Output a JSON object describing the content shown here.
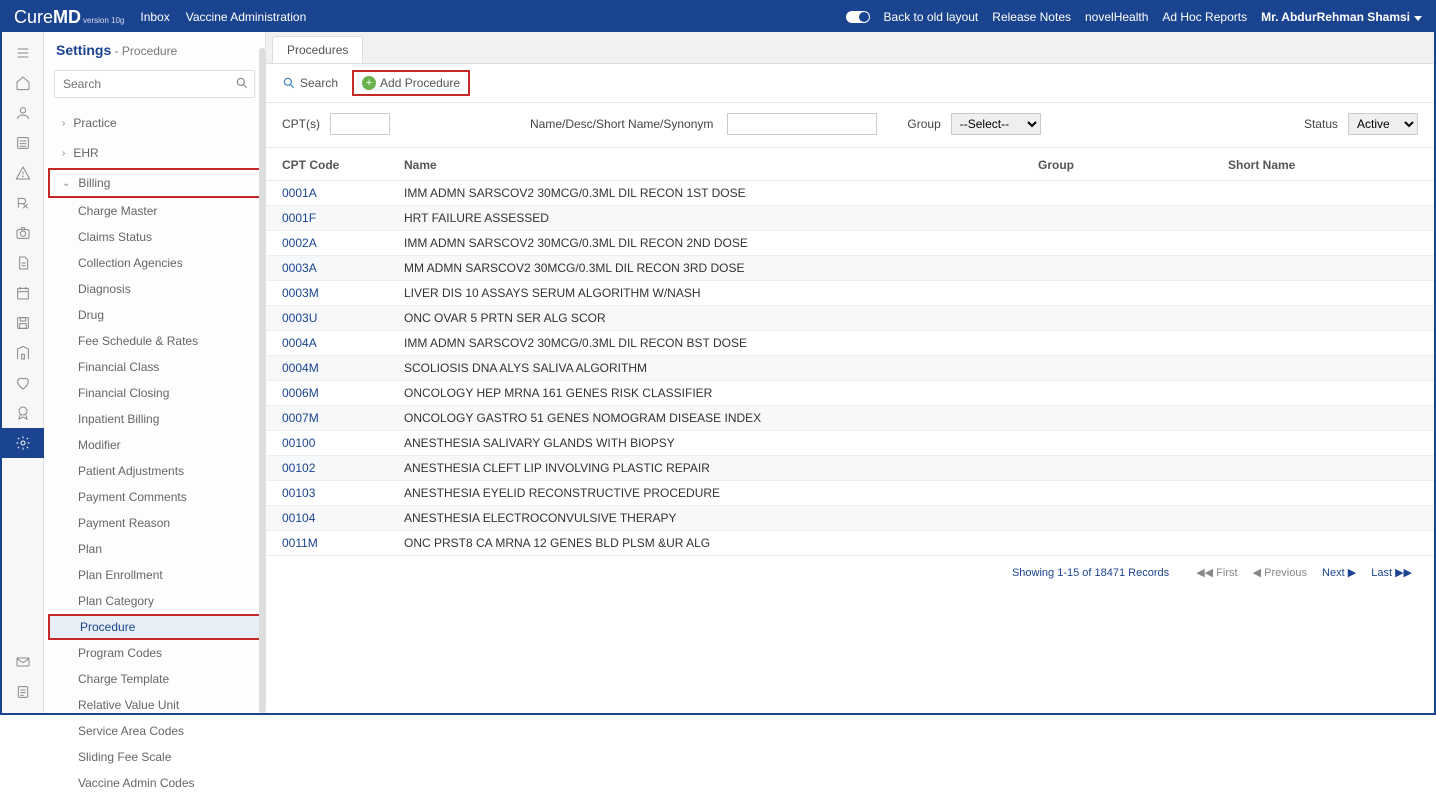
{
  "header": {
    "logo_text_a": "Cure",
    "logo_text_b": "MD",
    "logo_version": "version 10g",
    "links_left": [
      "Inbox",
      "Vaccine Administration"
    ],
    "links_right": [
      "Back to old layout",
      "Release Notes",
      "novelHealth",
      "Ad Hoc Reports"
    ],
    "user_name": "Mr. AbdurRehman Shamsi"
  },
  "sidebar": {
    "title": "Settings",
    "subtitle": " - Procedure",
    "search_placeholder": "Search",
    "sections": {
      "practice": "Practice",
      "ehr": "EHR",
      "billing": "Billing"
    },
    "billing_items": [
      "Charge Master",
      "Claims Status",
      "Collection Agencies",
      "Diagnosis",
      "Drug",
      "Fee Schedule & Rates",
      "Financial Class",
      "Financial Closing",
      "Inpatient Billing",
      "Modifier",
      "Patient Adjustments",
      "Payment Comments",
      "Payment Reason",
      "Plan",
      "Plan Enrollment",
      "Plan Category",
      "Procedure",
      "Program Codes",
      "Charge Template",
      "Relative Value Unit",
      "Service Area Codes",
      "Sliding Fee Scale",
      "Vaccine Admin Codes"
    ],
    "active_item_index": 16
  },
  "content": {
    "tab": "Procedures",
    "toolbar": {
      "search": "Search",
      "add": "Add Procedure"
    },
    "filters": {
      "cpts_label": "CPT(s)",
      "name_label": "Name/Desc/Short Name/Synonym",
      "group_label": "Group",
      "group_value": "--Select--",
      "status_label": "Status",
      "status_value": "Active"
    },
    "columns": {
      "code": "CPT Code",
      "name": "Name",
      "group": "Group",
      "short": "Short Name"
    },
    "rows": [
      {
        "code": "0001A",
        "name": "IMM ADMN SARSCOV2 30MCG/0.3ML DIL RECON 1ST DOSE"
      },
      {
        "code": "0001F",
        "name": "HRT FAILURE ASSESSED"
      },
      {
        "code": "0002A",
        "name": "IMM ADMN SARSCOV2 30MCG/0.3ML DIL RECON 2ND DOSE"
      },
      {
        "code": "0003A",
        "name": "MM ADMN SARSCOV2 30MCG/0.3ML DIL RECON 3RD DOSE"
      },
      {
        "code": "0003M",
        "name": "LIVER DIS 10 ASSAYS SERUM ALGORITHM W/NASH"
      },
      {
        "code": "0003U",
        "name": "ONC OVAR 5 PRTN SER ALG SCOR"
      },
      {
        "code": "0004A",
        "name": "IMM ADMN SARSCOV2 30MCG/0.3ML DIL RECON BST DOSE"
      },
      {
        "code": "0004M",
        "name": "SCOLIOSIS DNA ALYS SALIVA ALGORITHM"
      },
      {
        "code": "0006M",
        "name": "ONCOLOGY HEP MRNA 161 GENES RISK CLASSIFIER"
      },
      {
        "code": "0007M",
        "name": "ONCOLOGY GASTRO 51 GENES NOMOGRAM DISEASE INDEX"
      },
      {
        "code": "00100",
        "name": "ANESTHESIA SALIVARY GLANDS WITH BIOPSY"
      },
      {
        "code": "00102",
        "name": "ANESTHESIA CLEFT LIP INVOLVING PLASTIC REPAIR"
      },
      {
        "code": "00103",
        "name": "ANESTHESIA EYELID RECONSTRUCTIVE PROCEDURE"
      },
      {
        "code": "00104",
        "name": "ANESTHESIA ELECTROCONVULSIVE THERAPY"
      },
      {
        "code": "0011M",
        "name": "ONC PRST8 CA MRNA 12 GENES BLD PLSM &UR ALG"
      }
    ],
    "pager": {
      "showing": "Showing 1-15 of 18471 Records",
      "first": "First",
      "prev": "Previous",
      "next": "Next",
      "last": "Last"
    }
  }
}
